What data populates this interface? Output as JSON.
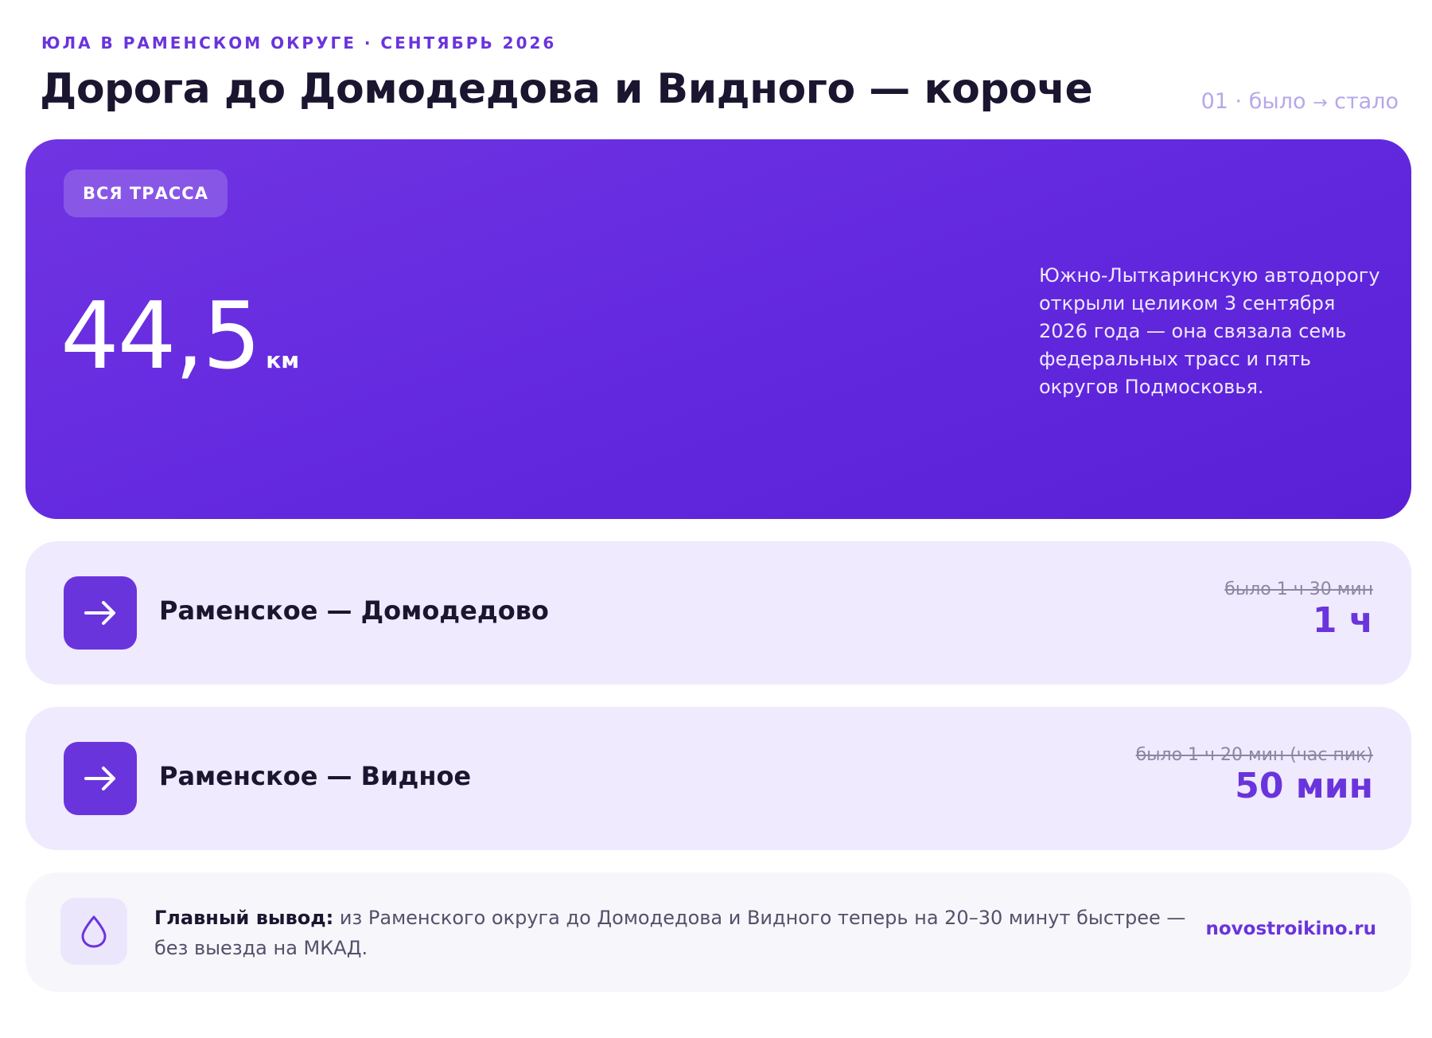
{
  "header": {
    "kicker": "ЮЛА В РАМЕНСКОМ ОКРУГЕ · СЕНТЯБРЬ 2026",
    "title": "Дорога до Домодедова и Видного — короче",
    "page_number": "01",
    "page_tag_before": "было",
    "page_tag_arrow": "→",
    "page_tag_after": "стало"
  },
  "hero": {
    "badge": "ВСЯ ТРАССА",
    "value": "44,5",
    "unit": "км",
    "description": "Южно-Лыткаринскую автодорогу открыли целиком 3 сентября 2026 года — она связала семь федеральных трасс и пять округов Подмосковья."
  },
  "routes": [
    {
      "name": "Раменское — Домодедово",
      "old_time": "было 1 ч 30 мин",
      "new_time": "1 ч"
    },
    {
      "name": "Раменское — Видное",
      "old_time": "было 1 ч 20 мин (час пик)",
      "new_time": "50 мин"
    }
  ],
  "summary": {
    "lead": "Главный вывод:",
    "text": " из Раменского округа до Домодедова и Видного теперь на 20–30 минут быстрее — без выезда на МКАД.",
    "site": "novostroikino.ru"
  },
  "icons": {
    "route": "arrow-right-icon",
    "summary": "drop-icon"
  },
  "colors": {
    "accent": "#6a34dc",
    "hero_gradient_start": "#7034e2",
    "hero_gradient_end": "#5a20d6",
    "route_card_bg": "#efeafd",
    "summary_card_bg": "#f7f6fb"
  }
}
